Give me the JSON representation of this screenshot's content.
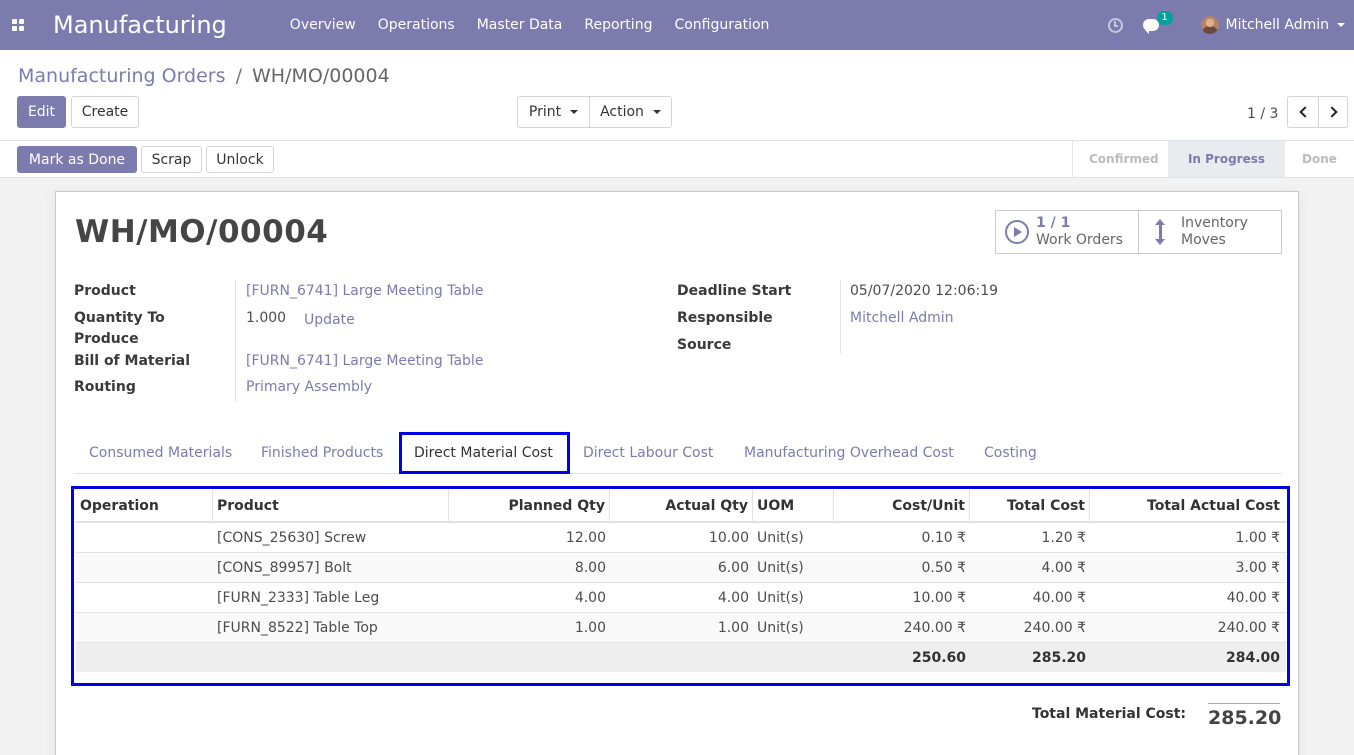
{
  "navbar": {
    "brand": "Manufacturing",
    "menu": [
      "Overview",
      "Operations",
      "Master Data",
      "Reporting",
      "Configuration"
    ],
    "messages_count": "1",
    "user_name": "Mitchell Admin"
  },
  "breadcrumb": {
    "parent": "Manufacturing Orders",
    "separator": "/",
    "current": "WH/MO/00004"
  },
  "buttons": {
    "edit": "Edit",
    "create": "Create",
    "print": "Print",
    "action": "Action",
    "mark_as_done": "Mark as Done",
    "scrap": "Scrap",
    "unlock": "Unlock"
  },
  "pager": {
    "value": "1 / 3"
  },
  "stages": [
    {
      "label": "Confirmed",
      "active": false
    },
    {
      "label": "In Progress",
      "active": true
    },
    {
      "label": "Done",
      "active": false
    }
  ],
  "record": {
    "title": "WH/MO/00004",
    "smart_buttons": {
      "work_orders_value": "1 / 1",
      "work_orders_label": "Work Orders",
      "moves_line1": "Inventory",
      "moves_line2": "Moves"
    },
    "fields": {
      "product_label": "Product",
      "product_value": "[FURN_6741] Large Meeting Table",
      "qty_label_1": "Quantity To",
      "qty_label_2": "Produce",
      "qty_value": "1.000",
      "update_link": "Update",
      "bom_label": "Bill of Material",
      "bom_value": "[FURN_6741] Large Meeting Table",
      "routing_label": "Routing",
      "routing_value": "Primary Assembly",
      "deadline_label": "Deadline Start",
      "deadline_value": "05/07/2020 12:06:19",
      "responsible_label": "Responsible",
      "responsible_value": "Mitchell Admin",
      "source_label": "Source"
    }
  },
  "tabs": [
    "Consumed Materials",
    "Finished Products",
    "Direct Material Cost",
    "Direct Labour Cost",
    "Manufacturing Overhead Cost",
    "Costing"
  ],
  "table": {
    "headers": [
      "Operation",
      "Product",
      "Planned Qty",
      "Actual Qty",
      "UOM",
      "Cost/Unit",
      "Total Cost",
      "Total Actual Cost"
    ],
    "rows": [
      [
        "",
        "[CONS_25630] Screw",
        "12.00",
        "10.00",
        "Unit(s)",
        "0.10 ₹",
        "1.20 ₹",
        "1.00 ₹"
      ],
      [
        "",
        "[CONS_89957] Bolt",
        "8.00",
        "6.00",
        "Unit(s)",
        "0.50 ₹",
        "4.00 ₹",
        "3.00 ₹"
      ],
      [
        "",
        "[FURN_2333] Table Leg",
        "4.00",
        "4.00",
        "Unit(s)",
        "10.00 ₹",
        "40.00 ₹",
        "40.00 ₹"
      ],
      [
        "",
        "[FURN_8522] Table Top",
        "1.00",
        "1.00",
        "Unit(s)",
        "240.00 ₹",
        "240.00 ₹",
        "240.00 ₹"
      ]
    ],
    "totals": {
      "cost_unit": "250.60",
      "total_cost": "285.20",
      "total_actual_cost": "284.00"
    }
  },
  "total_material_cost": {
    "label": "Total Material Cost:",
    "value": "285.20"
  }
}
